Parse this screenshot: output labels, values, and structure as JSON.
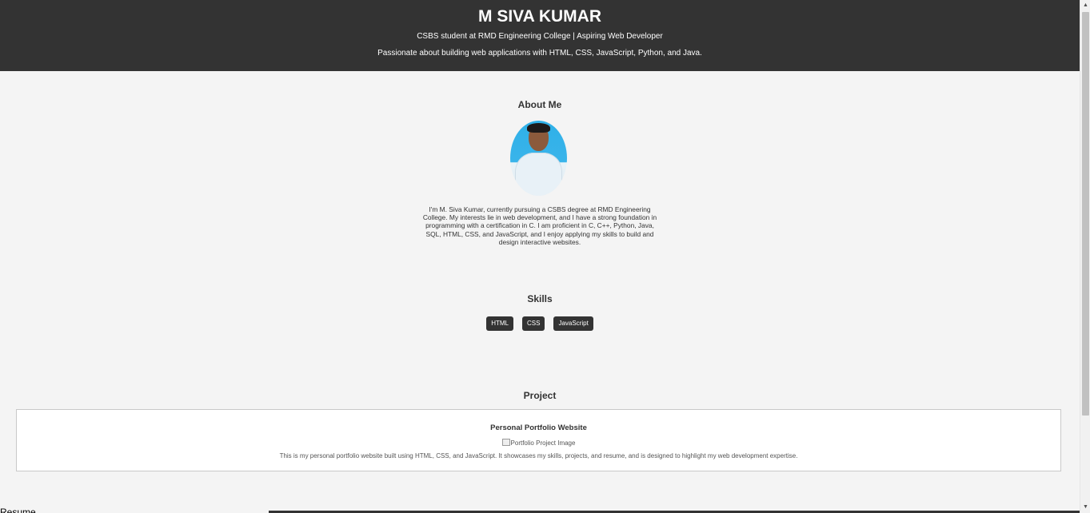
{
  "header": {
    "name": "M SIVA KUMAR",
    "tagline": "CSBS student at RMD Engineering College | Aspiring Web Developer",
    "passion": "Passionate about building web applications with HTML, CSS, JavaScript, Python, and Java."
  },
  "about": {
    "title": "About Me",
    "text": "I'm M. Siva Kumar, currently pursuing a CSBS degree at RMD Engineering College. My interests lie in web development, and I have a strong foundation in programming with a certification in C. I am proficient in C, C++, Python, Java, SQL, HTML, CSS, and JavaScript, and I enjoy applying my skills to build and design interactive websites."
  },
  "skills": {
    "title": "Skills",
    "items": [
      "HTML",
      "CSS",
      "JavaScript"
    ]
  },
  "project": {
    "title": "Project",
    "card_title": "Personal Portfolio Website",
    "image_alt": "Portfolio Project Image",
    "description": "This is my personal portfolio website built using HTML, CSS, and JavaScript. It showcases my skills, projects, and resume, and is designed to highlight my web development expertise."
  },
  "resume": {
    "title": "Resume"
  },
  "scrollbar": {
    "up_icon": "arrow-up-icon",
    "down_icon": "arrow-down-icon"
  }
}
